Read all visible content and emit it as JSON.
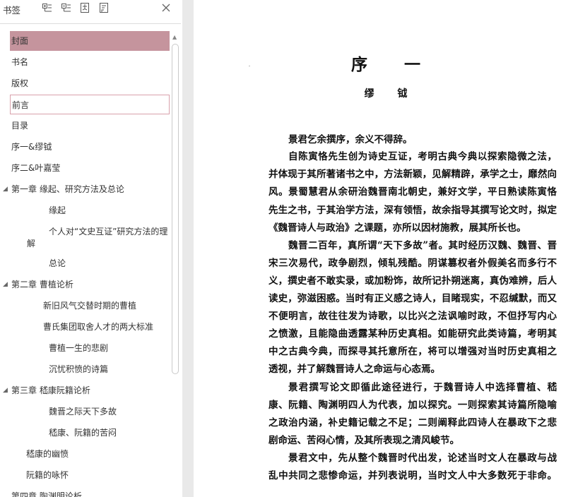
{
  "sidebar": {
    "title": "书签",
    "toolbar_icons": [
      "expand-all-icon",
      "collapse-all-icon",
      "add-bookmark-icon",
      "bookmark-settings-icon"
    ],
    "items": [
      {
        "label": "封面",
        "level": 0,
        "selected": true
      },
      {
        "label": "书名",
        "level": 0
      },
      {
        "label": "版权",
        "level": 0
      },
      {
        "label": "前言",
        "level": 0,
        "focused": true
      },
      {
        "label": "目录",
        "level": 0
      },
      {
        "label": "序一&缪钺",
        "level": 0
      },
      {
        "label": "序二&叶嘉莹",
        "level": 0
      },
      {
        "label": "第一章  缘起、研究方法及总论",
        "level": 0,
        "expanded": true
      },
      {
        "label": "缘起",
        "level": 2
      },
      {
        "label": "个人对“文史互证”研究方法的理解",
        "level": 2
      },
      {
        "label": "总论",
        "level": 2
      },
      {
        "label": "第二章  曹植论析",
        "level": 0,
        "expanded": true
      },
      {
        "label": "新旧风气交替时期的曹植",
        "level": 1
      },
      {
        "label": "曹氏集团取舍人才的两大标准",
        "level": 1
      },
      {
        "label": "曹植一生的悲剧",
        "level": 2
      },
      {
        "label": "沉忧积愤的诗篇",
        "level": 2
      },
      {
        "label": "第三章  嵇康阮籍论析",
        "level": 0,
        "expanded": true
      },
      {
        "label": "魏晋之际天下多故",
        "level": 2
      },
      {
        "label": "嵇康、阮籍的苦闷",
        "level": 2
      },
      {
        "label": "嵇康的幽愤",
        "level": 3
      },
      {
        "label": "阮籍的咏怀",
        "level": 3
      },
      {
        "label": "第四章  陶渊明论析",
        "level": 0
      }
    ]
  },
  "page": {
    "title": "序 一",
    "author": "缪 钺",
    "lines": [
      "景君乞余撰序，余义不得辞。",
      "自陈寅恪先生创为诗史互证，考明古典今典以探索隐微之法，",
      "并体现于其所著诸书之中，方法新颖，见解精辟，承学之士，靡然向",
      "风。景蜀慧君从余研治魏晋南北朝史，兼好文学，平日熟读陈寅恪",
      "先生之书，于其治学方法，深有领悟，故余指导其撰写论文时，拟定",
      "《魏晋诗人与政治》之课题，亦所以因材施教，展其所长也。",
      "魏晋二百年，真所谓“天下多故”者。其时经历汉魏、魏晋、晋",
      "宋三次易代，政争剧烈，倾轧残酷。阴谋篡权者外假美名而多行不",
      "义，撰史者不敢实录，或加粉饰，故所记扑朔迷离，真伪难辨，后人",
      "读史，弥滋困惑。当时有正义感之诗人，目睹现实，不忍缄默，而又",
      "不便明言，故往往发为诗歌，以比兴之法讽喻时政，不但抒写内心",
      "之愤激，且能隐曲透露某种历史真相。如能研究此类诗篇，考明其",
      "中之古典今典，而探寻其托意所在，将可以增强对当时历史真相之",
      "透视，并了解魏晋诗人之命运与心态焉。",
      "景君撰写论文即循此途径进行，于魏晋诗人中选择曹植、嵇",
      "康、阮籍、陶渊明四人为代表，加以探究。一则探索其诗篇所隐喻",
      "之政治内涵，补史籍记载之不足；二则阐释此四诗人在暴政下之悲",
      "剧命运、苦闷心情，及其所表现之清风峻节。",
      "景君文中，先从整个魏晋时代出发，论述当时文人在暴政与战",
      "乱中共同之悲惨命运，并列表说明，当时文人中大多数死于非命。"
    ],
    "paragraph_starts": [
      0,
      1,
      6,
      14,
      18
    ],
    "paragraph_ends": [
      0,
      5,
      13,
      17
    ]
  }
}
